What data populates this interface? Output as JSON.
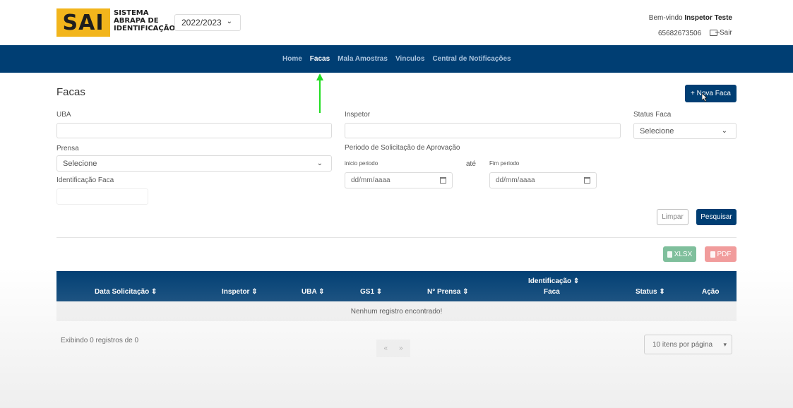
{
  "header": {
    "logo_text": "SAI",
    "logo_subtitle_lines": [
      "SISTEMA",
      "ABRAPA DE",
      "IDENTIFICAÇÃO"
    ],
    "year_select": "2022/2023",
    "welcome_prefix": "Bem-vindo",
    "user_name": "Inspetor Teste",
    "user_id": "65682673506",
    "logout_label": "Sair"
  },
  "nav": {
    "items": [
      {
        "label": "Home",
        "active": false
      },
      {
        "label": "Facas",
        "active": true
      },
      {
        "label": "Mala Amostras",
        "active": false
      },
      {
        "label": "Vinculos",
        "active": false
      },
      {
        "label": "Central de Notificações",
        "active": false
      }
    ]
  },
  "page": {
    "title": "Facas",
    "new_button": "+ Nova Faca"
  },
  "filters": {
    "uba_label": "UBA",
    "uba_value": "",
    "inspetor_label": "Inspetor",
    "inspetor_value": "",
    "status_label": "Status Faca",
    "status_value": "Selecione",
    "prensa_label": "Prensa",
    "prensa_value": "Selecione",
    "periodo_label": "Periodo de Solicitação de Aprovação",
    "inicio_label": "inicio periodo",
    "inicio_placeholder": "dd/mm/aaaa",
    "ate_label": "até",
    "fim_label": "Fim periodo",
    "fim_placeholder": "dd/mm/aaaa",
    "identificacao_label": "Identificação Faca",
    "identificacao_value": "",
    "clear_button": "Limpar",
    "search_button": "Pesquisar"
  },
  "exports": {
    "xlsx": "XLSX",
    "pdf": "PDF"
  },
  "table": {
    "columns": [
      "Data Solicitação ⇕",
      "Inspetor ⇕",
      "UBA ⇕",
      "GS1 ⇕",
      "N° Prensa ⇕",
      "Identificação ⇕",
      "Faca",
      "Status ⇕",
      "Ação"
    ],
    "empty_message": "Nenhum registro encontrado!"
  },
  "footer": {
    "records_text": "Exibindo 0 registros de 0",
    "prev": "«",
    "next": "»",
    "per_page": "10 itens por página"
  },
  "colors": {
    "navbar": "#003e73",
    "logo": "#f2b51c",
    "xlsx": "#7fbf9c",
    "pdf": "#f19c9c",
    "annotation_arrow": "#22dd22"
  }
}
